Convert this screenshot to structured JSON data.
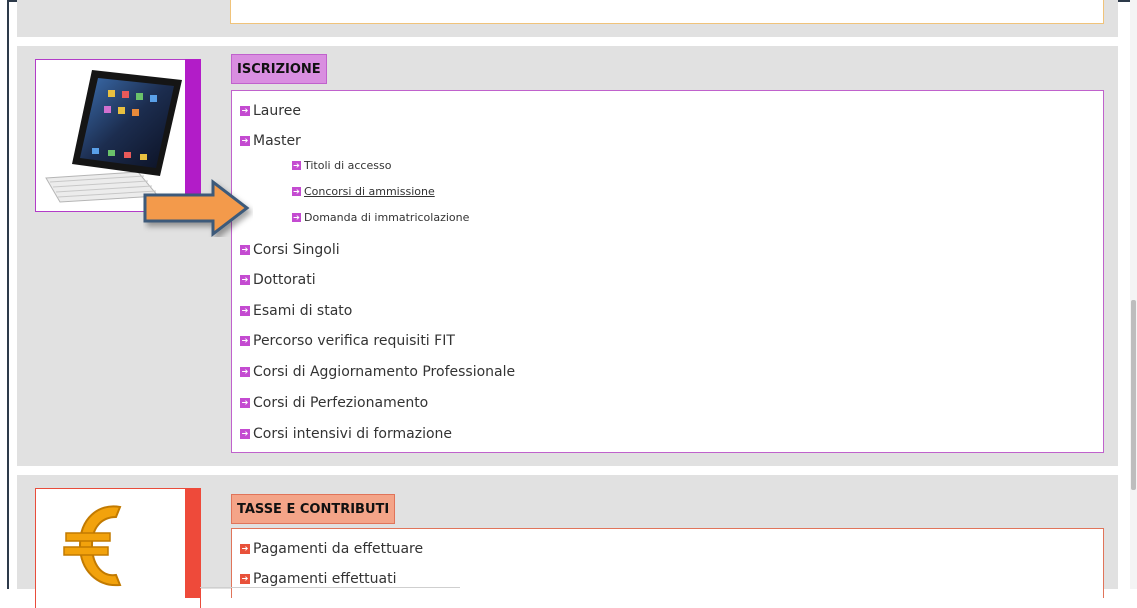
{
  "iscrizione": {
    "title": "ISCRIZIONE",
    "items": [
      {
        "label": "Lauree"
      },
      {
        "label": "Master"
      },
      {
        "label": "Titoli di accesso"
      },
      {
        "label": "Concorsi di ammissione"
      },
      {
        "label": "Domanda di immatricolazione"
      },
      {
        "label": "Corsi Singoli"
      },
      {
        "label": "Dottorati"
      },
      {
        "label": "Esami di stato"
      },
      {
        "label": "Percorso verifica requisiti FIT"
      },
      {
        "label": "Corsi di Aggiornamento Professionale"
      },
      {
        "label": "Corsi di Perfezionamento"
      },
      {
        "label": "Corsi intensivi di formazione"
      }
    ],
    "image_icon": "tablet-keyboard-icon",
    "accent_color": "#b21cc8"
  },
  "tasse": {
    "title": "TASSE E CONTRIBUTI",
    "items": [
      {
        "label": "Pagamenti da effettuare"
      },
      {
        "label": "Pagamenti effettuati"
      }
    ],
    "image_icon": "euro-icon",
    "accent_color": "#ee4a3a"
  },
  "annotation": {
    "icon": "orange-arrow-icon",
    "color": "#f39a4c"
  }
}
